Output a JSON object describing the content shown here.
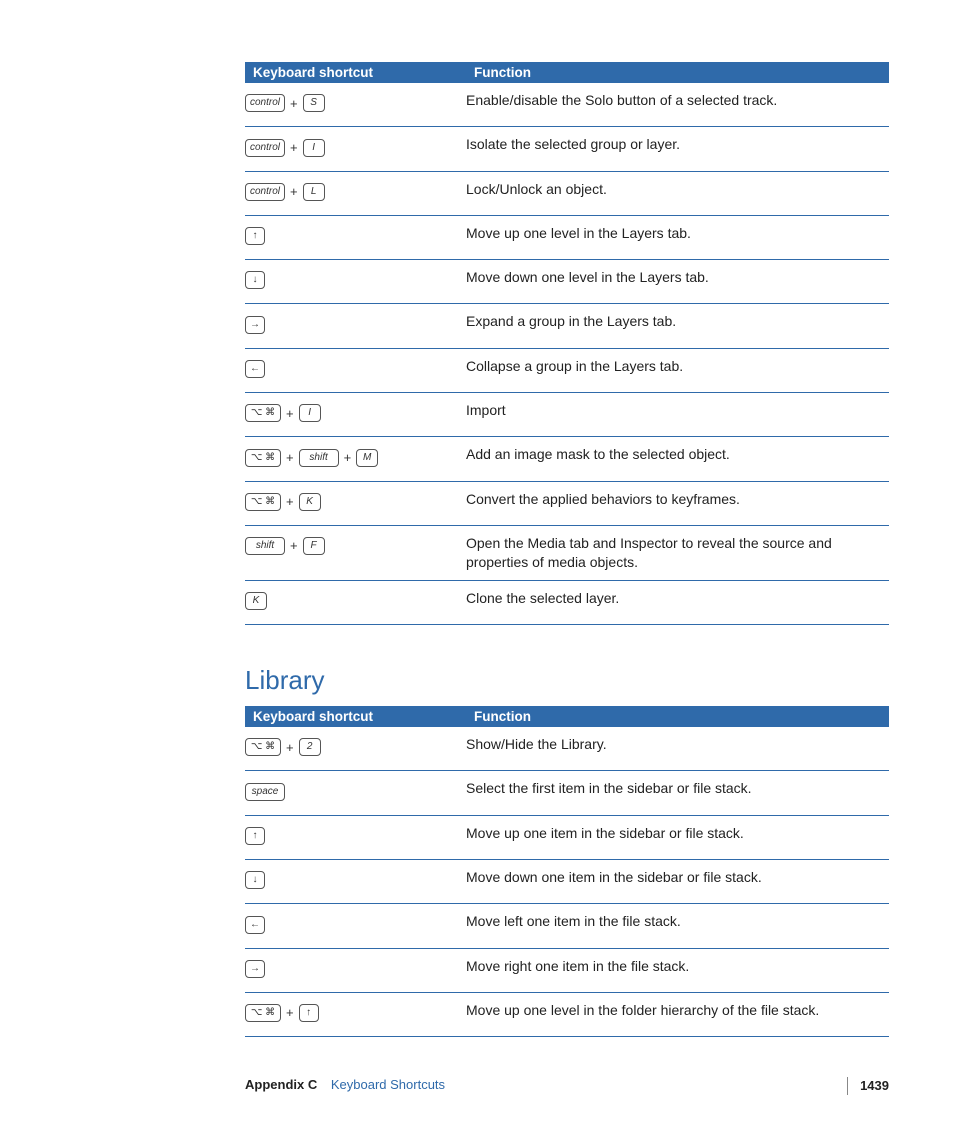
{
  "table1": {
    "headers": {
      "shortcut": "Keyboard shortcut",
      "function": "Function"
    },
    "rows": [
      {
        "keys": [
          {
            "t": "text",
            "v": "control",
            "cls": "modwide"
          },
          {
            "t": "plus"
          },
          {
            "t": "text",
            "v": "S"
          }
        ],
        "fn": "Enable/disable the Solo button of a selected track."
      },
      {
        "keys": [
          {
            "t": "text",
            "v": "control",
            "cls": "modwide"
          },
          {
            "t": "plus"
          },
          {
            "t": "text",
            "v": "I"
          }
        ],
        "fn": "Isolate the selected group or layer."
      },
      {
        "keys": [
          {
            "t": "text",
            "v": "control",
            "cls": "modwide"
          },
          {
            "t": "plus"
          },
          {
            "t": "text",
            "v": "L"
          }
        ],
        "fn": "Lock/Unlock an object."
      },
      {
        "keys": [
          {
            "t": "arrow",
            "v": "↑"
          }
        ],
        "fn": "Move up one level in the Layers tab."
      },
      {
        "keys": [
          {
            "t": "arrow",
            "v": "↓"
          }
        ],
        "fn": "Move down one level in the Layers tab."
      },
      {
        "keys": [
          {
            "t": "arrow",
            "v": "→"
          }
        ],
        "fn": "Expand a group in the Layers tab."
      },
      {
        "keys": [
          {
            "t": "arrow",
            "v": "←"
          }
        ],
        "fn": "Collapse a group in the Layers tab."
      },
      {
        "keys": [
          {
            "t": "cmd"
          },
          {
            "t": "plus"
          },
          {
            "t": "text",
            "v": "I"
          }
        ],
        "fn": "Import"
      },
      {
        "keys": [
          {
            "t": "cmd"
          },
          {
            "t": "plus"
          },
          {
            "t": "text",
            "v": "shift",
            "cls": "modwide"
          },
          {
            "t": "plus"
          },
          {
            "t": "text",
            "v": "M"
          }
        ],
        "fn": "Add an image mask to the selected object."
      },
      {
        "keys": [
          {
            "t": "cmd"
          },
          {
            "t": "plus"
          },
          {
            "t": "text",
            "v": "K"
          }
        ],
        "fn": "Convert the applied behaviors to keyframes."
      },
      {
        "keys": [
          {
            "t": "text",
            "v": "shift",
            "cls": "modwide"
          },
          {
            "t": "plus"
          },
          {
            "t": "text",
            "v": "F"
          }
        ],
        "fn": "Open the Media tab and Inspector to reveal the source and properties of media objects."
      },
      {
        "keys": [
          {
            "t": "text",
            "v": "K"
          }
        ],
        "fn": "Clone the selected layer."
      }
    ]
  },
  "section2_title": "Library",
  "table2": {
    "headers": {
      "shortcut": "Keyboard shortcut",
      "function": "Function"
    },
    "rows": [
      {
        "keys": [
          {
            "t": "cmd"
          },
          {
            "t": "plus"
          },
          {
            "t": "text",
            "v": "2"
          }
        ],
        "fn": "Show/Hide the Library."
      },
      {
        "keys": [
          {
            "t": "text",
            "v": "space",
            "cls": "modwide"
          }
        ],
        "fn": "Select the first item in the sidebar or file stack."
      },
      {
        "keys": [
          {
            "t": "arrow",
            "v": "↑"
          }
        ],
        "fn": "Move up one item in the sidebar or file stack."
      },
      {
        "keys": [
          {
            "t": "arrow",
            "v": "↓"
          }
        ],
        "fn": "Move down one item in the sidebar or file stack."
      },
      {
        "keys": [
          {
            "t": "arrow",
            "v": "←"
          }
        ],
        "fn": "Move left one item in the file stack."
      },
      {
        "keys": [
          {
            "t": "arrow",
            "v": "→"
          }
        ],
        "fn": "Move right one item in the file stack."
      },
      {
        "keys": [
          {
            "t": "cmd"
          },
          {
            "t": "plus"
          },
          {
            "t": "arrow",
            "v": "↑"
          }
        ],
        "fn": "Move up one level in the folder hierarchy of the file stack."
      }
    ]
  },
  "footer": {
    "appendix": "Appendix C",
    "title": "Keyboard Shortcuts",
    "page": "1439"
  }
}
